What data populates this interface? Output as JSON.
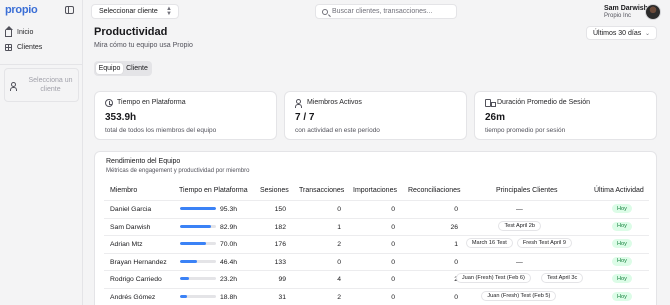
{
  "app": {
    "logo": "propio"
  },
  "sidebar": {
    "items": [
      {
        "label": "Inicio",
        "icon": "home-icon"
      },
      {
        "label": "Clientes",
        "icon": "grid-icon"
      }
    ],
    "client_empty": "Selecciona un cliente"
  },
  "header": {
    "client_select": "Seleccionar cliente",
    "search_placeholder": "Buscar clientes, transacciones...",
    "user_name": "Sam Darwish",
    "user_org": "Propio Inc"
  },
  "main": {
    "title": "Productividad",
    "subtitle": "Mira cómo tu equipo usa Propio",
    "range": "Últimos 30 días",
    "tabs": [
      {
        "label": "Equipo",
        "active": true
      },
      {
        "label": "Cliente",
        "active": false
      }
    ],
    "stats": [
      {
        "title": "Tiempo en Plataforma",
        "value": "353.9h",
        "desc": "total de todos los miembros del equipo",
        "icon": "clock-icon"
      },
      {
        "title": "Miembros Activos",
        "value": "7 / 7",
        "desc": "con actividad en este período",
        "icon": "users-icon"
      },
      {
        "title": "Duración Promedio de Sesión",
        "value": "26m",
        "desc": "tiempo promedio por sesión",
        "icon": "truck-icon"
      }
    ],
    "team": {
      "title": "Rendimiento del Equipo",
      "subtitle": "Métricas de engagement y productividad por miembro",
      "columns": [
        "Miembro",
        "Tiempo en Plataforma",
        "Sesiones",
        "Transacciones",
        "Importaciones",
        "Reconciliaciones",
        "Principales Clientes",
        "Última Actividad"
      ],
      "rows": [
        {
          "member": "Daniel Garcia",
          "time": "95.3h",
          "share": 0.99,
          "sessions": "150",
          "transactions": "0",
          "imports": "0",
          "reconciliations": "0",
          "clients": [
            "—"
          ],
          "last": "Hoy"
        },
        {
          "member": "Sam Darwish",
          "time": "82.9h",
          "share": 0.86,
          "sessions": "182",
          "transactions": "1",
          "imports": "0",
          "reconciliations": "26",
          "clients": [
            "Test April 2b"
          ],
          "last": "Hoy"
        },
        {
          "member": "Adrian Mtz",
          "time": "70.0h",
          "share": 0.73,
          "sessions": "176",
          "transactions": "2",
          "imports": "0",
          "reconciliations": "1",
          "clients": [
            "March 16 Test",
            "Fresh Test April 9"
          ],
          "last": "Hoy"
        },
        {
          "member": "Brayan Hernandez",
          "time": "46.4h",
          "share": 0.48,
          "sessions": "133",
          "transactions": "0",
          "imports": "0",
          "reconciliations": "0",
          "clients": [
            "—"
          ],
          "last": "Hoy"
        },
        {
          "member": "Rodrigo Carriedo",
          "time": "23.2h",
          "share": 0.24,
          "sessions": "99",
          "transactions": "4",
          "imports": "0",
          "reconciliations": "2",
          "clients": [
            "Juan (Fresh) Test (Feb 6)",
            "Test April 3c"
          ],
          "last": "Hoy"
        },
        {
          "member": "Andrés Gómez",
          "time": "18.8h",
          "share": 0.2,
          "sessions": "31",
          "transactions": "2",
          "imports": "0",
          "reconciliations": "0",
          "clients": [
            "Juan (Fresh) Test (Feb 5)"
          ],
          "last": "Hoy"
        }
      ]
    }
  }
}
